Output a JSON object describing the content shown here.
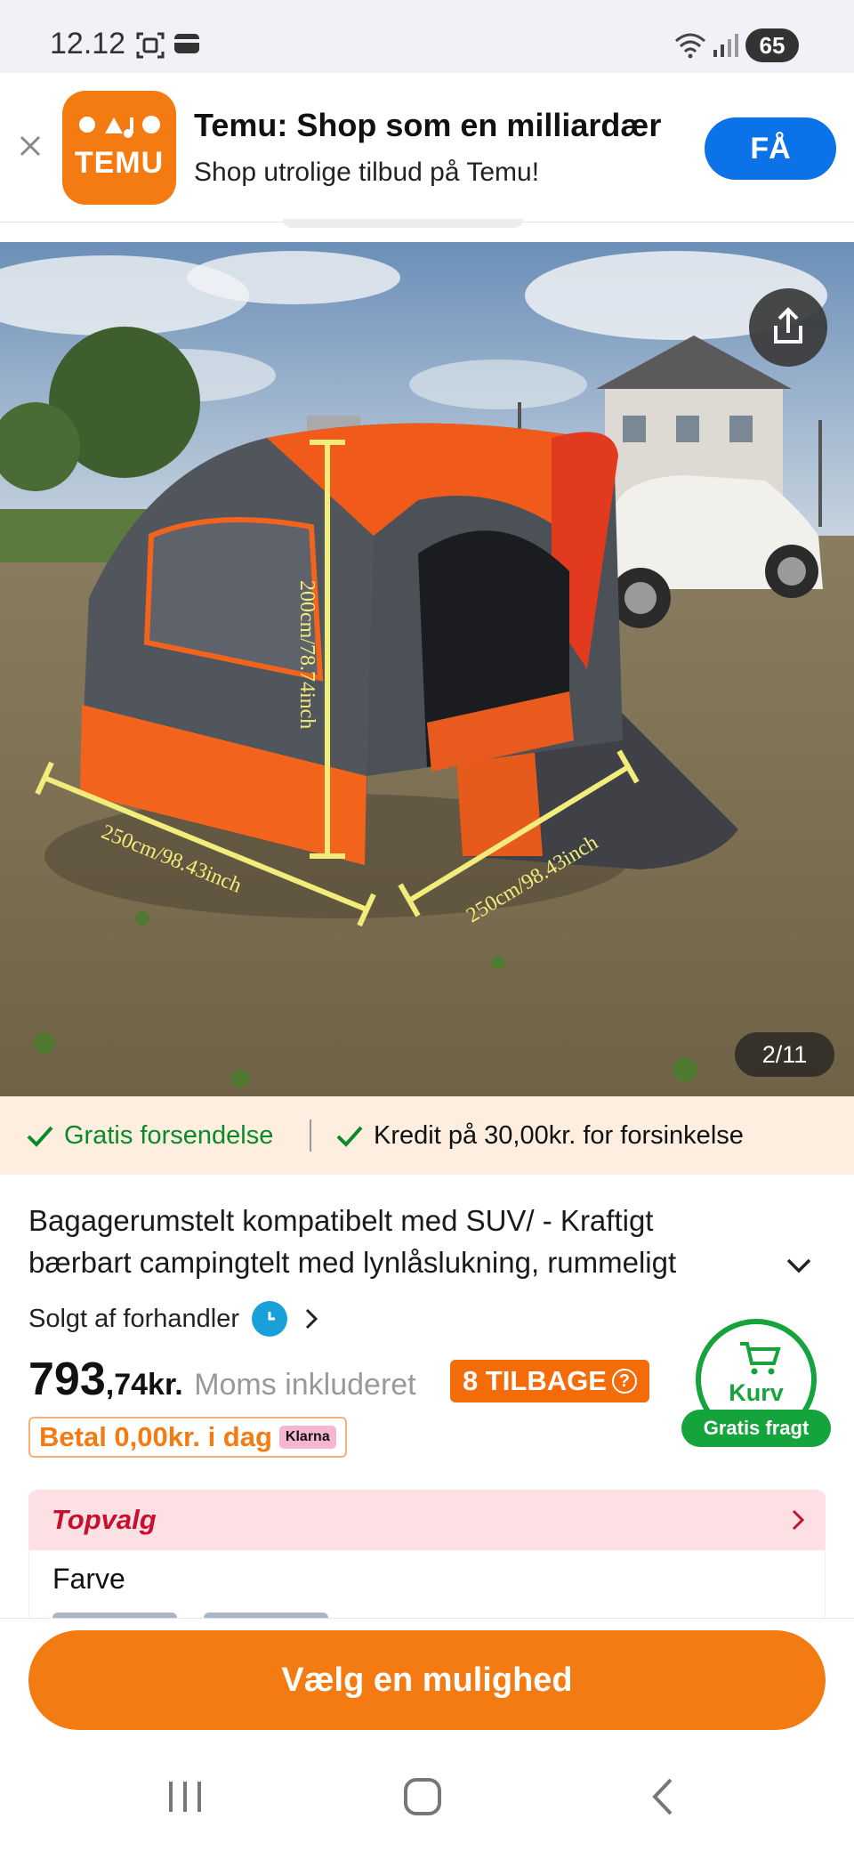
{
  "status_bar": {
    "time": "12.12",
    "battery": "65"
  },
  "banner": {
    "logo_text": "TEMU",
    "title": "Temu: Shop som en milliardær",
    "subtitle": "Shop utrolige tilbud på Temu!",
    "get_label": "FÅ",
    "accent": "#f47b12",
    "button_color": "#0b72e8"
  },
  "gallery": {
    "counter": "2/11",
    "dimensions": {
      "height": "200cm/78.74inch",
      "width": "250cm/98.43inch",
      "depth": "250cm/98.43inch"
    }
  },
  "shipping": {
    "free": "Gratis forsendelse",
    "credit": "Kredit på 30,00kr. for forsinkelse"
  },
  "product": {
    "title": "Bagagerumstelt kompatibelt med SUV/ - Kraftigt bærbart campingtelt med lynlåslukning, rummeligt",
    "seller": "Solgt af forhandler",
    "price_int": "793",
    "price_dec": ",74kr.",
    "vat": "Moms inkluderet",
    "returns": "8 TILBAGE",
    "pay": "Betal 0,00kr. i dag",
    "klarna": "Klarna"
  },
  "cart": {
    "label": "Kurv",
    "free_freight": "Gratis fragt",
    "color": "#15a33b"
  },
  "toppick": {
    "label": "Topvalg",
    "color_label": "Farve"
  },
  "cta": {
    "label": "Vælg en mulighed"
  }
}
